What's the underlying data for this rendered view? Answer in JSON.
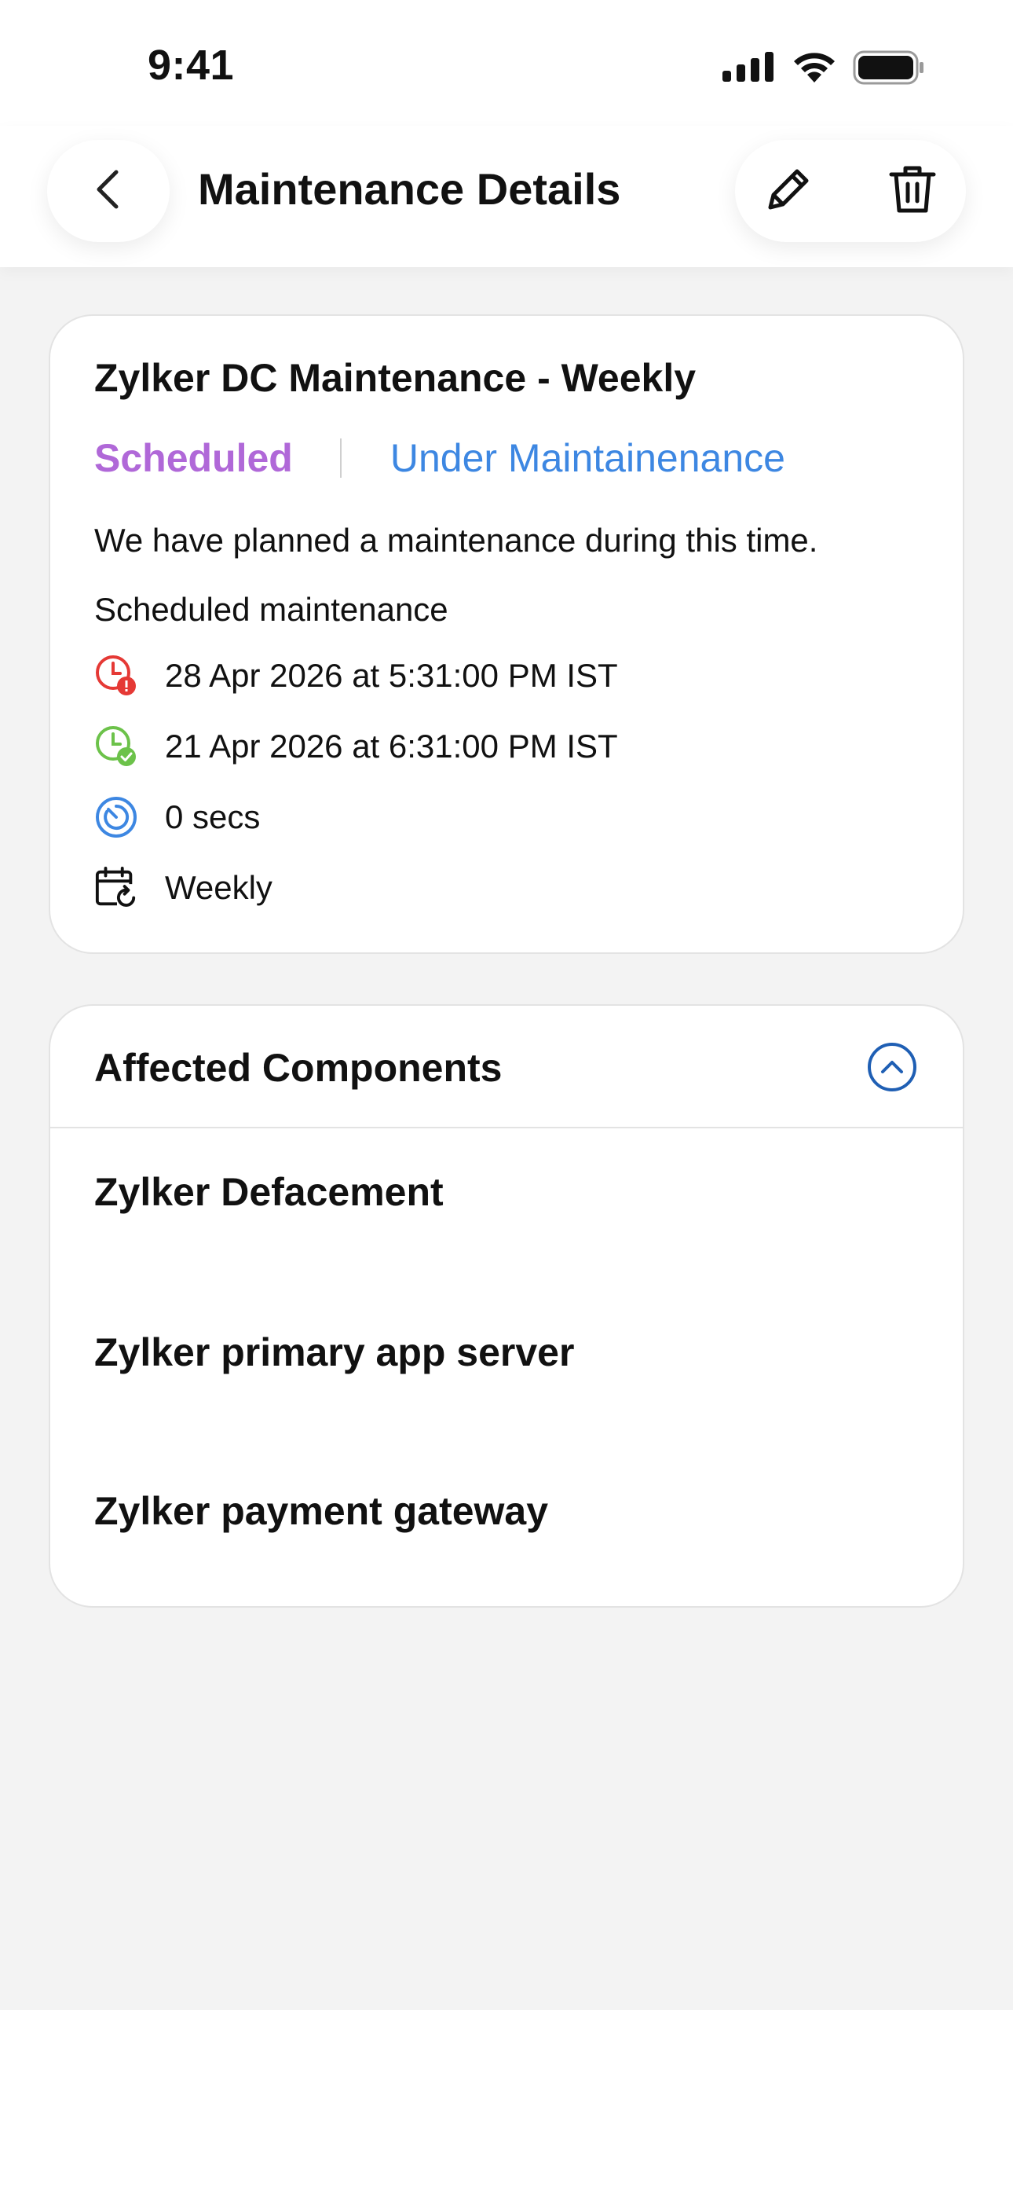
{
  "status_bar": {
    "time": "9:41",
    "icons": [
      "signal-icon",
      "wifi-icon",
      "battery-icon"
    ]
  },
  "header": {
    "title": "Maintenance Details",
    "icons": [
      "chevron-left-icon",
      "pencil-icon",
      "trash-icon"
    ]
  },
  "maintenance": {
    "title": "Zylker DC Maintenance - Weekly",
    "status": "Scheduled",
    "status_secondary": "Under Maintainenance",
    "description": "We have planned a maintenance during this time.",
    "type": "Scheduled maintenance",
    "end_time": "28 Apr 2026 at 5:31:00 PM IST",
    "start_time": "21 Apr 2026 at 6:31:00 PM IST",
    "duration": "0 secs",
    "recurrence": "Weekly",
    "icons": [
      "clock-alert-icon",
      "clock-check-icon",
      "timer-icon",
      "calendar-repeat-icon"
    ]
  },
  "components": {
    "heading": "Affected Components",
    "collapse_icon": "chevron-up-circle-icon",
    "items": [
      "Zylker Defacement",
      "Zylker primary app server",
      "Zylker payment gateway"
    ]
  },
  "colors": {
    "scheduled": "#b068d8",
    "under_maintenance": "#3d87e2",
    "alert_red": "#e53935",
    "success_green": "#6cc24a",
    "timer_blue": "#3d87e2",
    "page_background": "#f3f3f3"
  }
}
